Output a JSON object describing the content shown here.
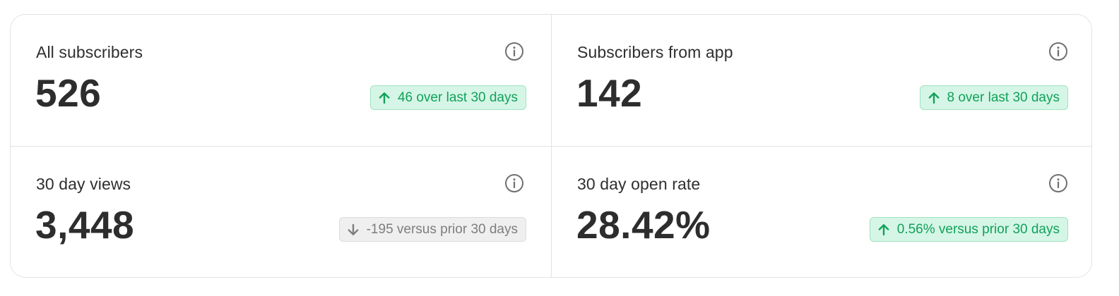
{
  "stats": [
    {
      "label": "All subscribers",
      "value": "526",
      "delta": "46 over last 30 days",
      "trend": "up",
      "info_icon": "info-circle-icon"
    },
    {
      "label": "Subscribers from app",
      "value": "142",
      "delta": "8 over last 30 days",
      "trend": "up",
      "info_icon": "info-circle-icon"
    },
    {
      "label": "30 day views",
      "value": "3,448",
      "delta": "-195 versus prior 30 days",
      "trend": "down",
      "info_icon": "info-circle-icon"
    },
    {
      "label": "30 day open rate",
      "value": "28.42%",
      "delta": "0.56% versus prior 30 days",
      "trend": "up",
      "info_icon": "info-circle-icon"
    }
  ],
  "colors": {
    "up_text": "#12a15b",
    "up_background": "#d5f6e6",
    "down_text": "#7e7e7e",
    "down_background": "#efefef",
    "value_text": "#2d2d2d",
    "border": "#e3e3e3"
  }
}
